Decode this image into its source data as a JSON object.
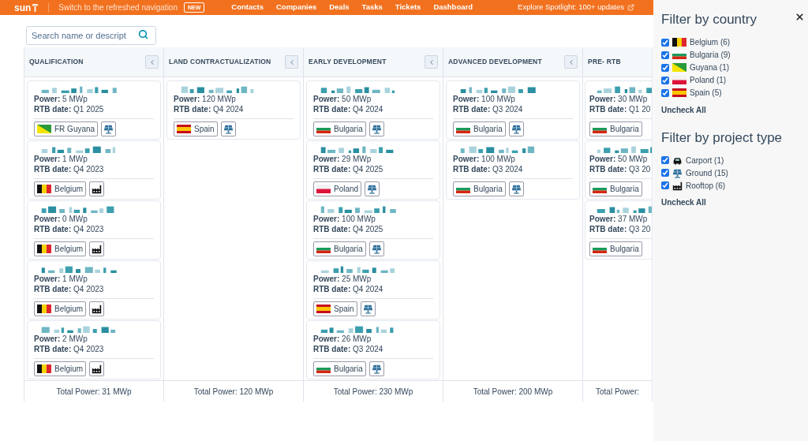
{
  "topbar": {
    "logo": "sun",
    "switch_text": "Switch to the refreshed navigation",
    "new_badge": "NEW",
    "nav": [
      {
        "label": "Contacts"
      },
      {
        "label": "Companies"
      },
      {
        "label": "Deals"
      },
      {
        "label": "Tasks"
      },
      {
        "label": "Tickets"
      },
      {
        "label": "Dashboard"
      }
    ],
    "spotlight": "Explore Spotlight: 100+ updates"
  },
  "search": {
    "placeholder": "Search name or descript"
  },
  "columns": [
    {
      "title": "QUALIFICATION",
      "collapsible": true,
      "total": "Total Power: 31 MWp",
      "cards": [
        {
          "power": "**Power:** 5 MWp",
          "rtb": "**RTB date:** Q1 2025",
          "country": {
            "name": "FR Guyana",
            "kind": "gf"
          },
          "project_type": {
            "kind": "ground"
          }
        },
        {
          "power": "**Power:** 1 MWp",
          "rtb": "**RTB date:** Q4 2023",
          "country": {
            "name": "Belgium",
            "kind": "be"
          },
          "project_type": {
            "kind": "rooftop"
          }
        },
        {
          "power": "**Power:** 0 MWp",
          "rtb": "**RTB date:** Q4 2023",
          "country": {
            "name": "Belgium",
            "kind": "be"
          },
          "project_type": {
            "kind": "rooftop"
          }
        },
        {
          "power": "**Power:** 1 MWp",
          "rtb": "**RTB date:** Q4 2023",
          "country": {
            "name": "Belgium",
            "kind": "be"
          },
          "project_type": {
            "kind": "rooftop"
          }
        },
        {
          "power": "**Power:** 2 MWp",
          "rtb": "**RTB date:** Q4 2023",
          "country": {
            "name": "Belgium",
            "kind": "be"
          },
          "project_type": {
            "kind": "rooftop"
          }
        }
      ]
    },
    {
      "title": "LAND CONTRACTUALIZATION",
      "collapsible": true,
      "total": "Total Power: 120 MWp",
      "cards": [
        {
          "power": "**Power:** 120 MWp",
          "rtb": "**RTB date:** Q4 2024",
          "country": {
            "name": "Spain",
            "kind": "es"
          },
          "project_type": {
            "kind": "ground"
          }
        }
      ]
    },
    {
      "title": "EARLY DEVELOPMENT",
      "collapsible": true,
      "total": "Total Power: 230 MWp",
      "cards": [
        {
          "power": "**Power:** 50 MWp",
          "rtb": "**RTB date:** Q4 2024",
          "country": {
            "name": "Bulgaria",
            "kind": "bg"
          },
          "project_type": {
            "kind": "ground"
          }
        },
        {
          "power": "**Power:** 29 MWp",
          "rtb": "**RTB date:** Q4 2025",
          "country": {
            "name": "Poland",
            "kind": "pl"
          },
          "project_type": {
            "kind": "ground"
          }
        },
        {
          "power": "**Power:** 100 MWp",
          "rtb": "**RTB date:** Q4 2025",
          "country": {
            "name": "Bulgaria",
            "kind": "bg"
          },
          "project_type": {
            "kind": "ground"
          }
        },
        {
          "power": "**Power:** 25 MWp",
          "rtb": "**RTB date:** Q4 2024",
          "country": {
            "name": "Spain",
            "kind": "es"
          },
          "project_type": {
            "kind": "ground"
          }
        },
        {
          "power": "**Power:** 26 MWp",
          "rtb": "**RTB date:** Q3 2024",
          "country": {
            "name": "Bulgaria",
            "kind": "bg"
          },
          "project_type": {
            "kind": "ground"
          }
        }
      ]
    },
    {
      "title": "ADVANCED DEVELOPMENT",
      "collapsible": true,
      "total": "Total Power: 200 MWp",
      "cards": [
        {
          "power": "**Power:** 100 MWp",
          "rtb": "**RTB date:** Q3 2024",
          "country": {
            "name": "Bulgaria",
            "kind": "bg"
          },
          "project_type": {
            "kind": "ground"
          }
        },
        {
          "power": "**Power:** 100 MWp",
          "rtb": "**RTB date:** Q3 2024",
          "country": {
            "name": "Bulgaria",
            "kind": "bg"
          },
          "project_type": {
            "kind": "ground"
          }
        }
      ]
    },
    {
      "title": "PRE- RTB",
      "collapsible": false,
      "total": "Total Power:",
      "cards": [
        {
          "power": "**Power:** 30 MWp",
          "rtb": "**RTB date:** Q1 20",
          "country": {
            "name": "Bulgaria",
            "kind": "bg"
          }
        },
        {
          "power": "**Power:** 50 MWp",
          "rtb": "**RTB date:** Q3 20",
          "country": {
            "name": "Bulgaria",
            "kind": "bg"
          }
        },
        {
          "power": "**Power:** 37 MWp",
          "rtb": "**RTB date:** Q3 20",
          "country": {
            "name": "Bulgaria",
            "kind": "bg"
          }
        }
      ]
    }
  ],
  "filters": [
    {
      "title": "Filter by country",
      "options": [
        {
          "label": "Belgium (6)",
          "icon": {
            "kind": "be"
          },
          "checked": true
        },
        {
          "label": "Bulgaria (9)",
          "icon": {
            "kind": "bg"
          },
          "checked": true
        },
        {
          "label": "Guyana (1)",
          "icon": {
            "kind": "gf"
          },
          "checked": true
        },
        {
          "label": "Poland (1)",
          "icon": {
            "kind": "pl"
          },
          "checked": true
        },
        {
          "label": "Spain (5)",
          "icon": {
            "kind": "es"
          },
          "checked": true
        }
      ],
      "action": "Uncheck All"
    },
    {
      "title": "Filter by project type",
      "options": [
        {
          "label": "Carport (1)",
          "icon": {
            "kind": "carport"
          },
          "checked": true
        },
        {
          "label": "Ground (15)",
          "icon": {
            "kind": "ground"
          },
          "checked": true
        },
        {
          "label": "Rooftop (6)",
          "icon": {
            "kind": "rooftop"
          },
          "checked": true
        }
      ],
      "action": "Uncheck All"
    }
  ]
}
